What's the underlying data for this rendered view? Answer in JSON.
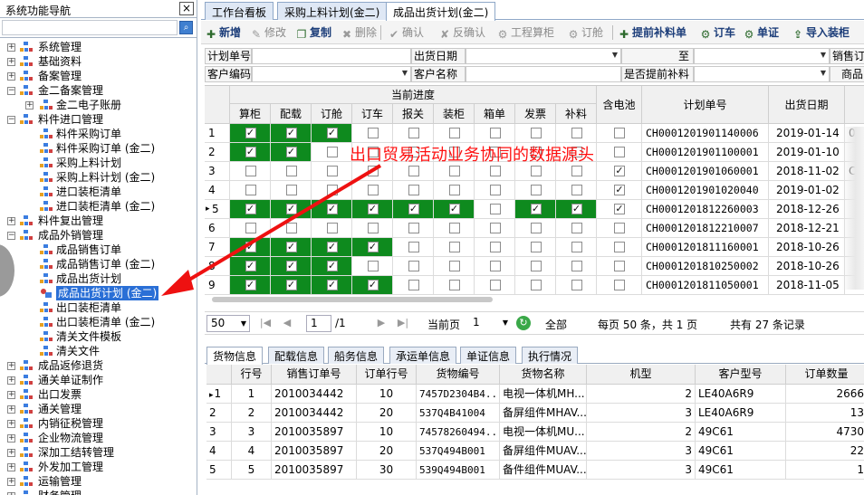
{
  "nav": {
    "title": "系统功能导航",
    "close": "×",
    "search_icon": "search-icon",
    "items": [
      {
        "label": "系统管理",
        "exp": "+",
        "level": 0
      },
      {
        "label": "基础资料",
        "exp": "+",
        "level": 0
      },
      {
        "label": "备案管理",
        "exp": "+",
        "level": 0
      },
      {
        "label": "金二备案管理",
        "exp": "−",
        "level": 0
      },
      {
        "label": "金二电子账册",
        "exp": "+",
        "level": 1
      },
      {
        "label": "料件进口管理",
        "exp": "−",
        "level": 0
      },
      {
        "label": "料件采购订单",
        "exp": "",
        "level": 1
      },
      {
        "label": "料件采购订单 (金二)",
        "exp": "",
        "level": 1
      },
      {
        "label": "采购上料计划",
        "exp": "",
        "level": 1
      },
      {
        "label": "采购上料计划 (金二)",
        "exp": "",
        "level": 1
      },
      {
        "label": "进口装柜清单",
        "exp": "",
        "level": 1
      },
      {
        "label": "进口装柜清单 (金二)",
        "exp": "",
        "level": 1
      },
      {
        "label": "料件复出管理",
        "exp": "+",
        "level": 0
      },
      {
        "label": "成品外销管理",
        "exp": "−",
        "level": 0
      },
      {
        "label": "成品销售订单",
        "exp": "",
        "level": 1
      },
      {
        "label": "成品销售订单 (金二)",
        "exp": "",
        "level": 1
      },
      {
        "label": "成品出货计划",
        "exp": "",
        "level": 1
      },
      {
        "label": "成品出货计划 (金二)",
        "exp": "",
        "level": 1,
        "selected": true
      },
      {
        "label": "出口装柜清单",
        "exp": "",
        "level": 1
      },
      {
        "label": "出口装柜清单 (金二)",
        "exp": "",
        "level": 1
      },
      {
        "label": "清关文件模板",
        "exp": "",
        "level": 1
      },
      {
        "label": "清关文件",
        "exp": "",
        "level": 1
      },
      {
        "label": "成品返修退货",
        "exp": "+",
        "level": 0
      },
      {
        "label": "通关单证制作",
        "exp": "+",
        "level": 0
      },
      {
        "label": "出口发票",
        "exp": "+",
        "level": 0
      },
      {
        "label": "通关管理",
        "exp": "+",
        "level": 0
      },
      {
        "label": "内销征税管理",
        "exp": "+",
        "level": 0
      },
      {
        "label": "企业物流管理",
        "exp": "+",
        "level": 0
      },
      {
        "label": "深加工结转管理",
        "exp": "+",
        "level": 0
      },
      {
        "label": "外发加工管理",
        "exp": "+",
        "level": 0
      },
      {
        "label": "运输管理",
        "exp": "+",
        "level": 0
      },
      {
        "label": "财务管理",
        "exp": "+",
        "level": 0
      }
    ]
  },
  "tabs": [
    "工作台看板",
    "采购上料计划(金二)",
    "成品出货计划(金二)"
  ],
  "toolbar": [
    {
      "icon": "plus-icon",
      "glyph": "✚",
      "label": "新增",
      "style": "bold"
    },
    {
      "icon": "edit-icon",
      "glyph": "✎",
      "label": "修改",
      "style": "dis"
    },
    {
      "icon": "copy-icon",
      "glyph": "❐",
      "label": "复制",
      "style": "bold"
    },
    {
      "icon": "delete-icon",
      "glyph": "✖",
      "label": "删除",
      "style": "dis"
    },
    {
      "icon": "check-icon",
      "glyph": "✔",
      "label": "确认",
      "style": "dis"
    },
    {
      "icon": "uncheck-icon",
      "glyph": "✘",
      "label": "反确认",
      "style": "dis"
    },
    {
      "icon": "gear-icon",
      "glyph": "⚙",
      "label": "工程算柜",
      "style": "dis"
    },
    {
      "icon": "gear-icon",
      "glyph": "⚙",
      "label": "订舱",
      "style": "dis"
    },
    {
      "icon": "plus-icon",
      "glyph": "✚",
      "label": "提前补料单",
      "style": "bold"
    },
    {
      "icon": "gear-icon",
      "glyph": "⚙",
      "label": "订车",
      "style": "bold"
    },
    {
      "icon": "gear-icon",
      "glyph": "⚙",
      "label": "单证",
      "style": "bold"
    },
    {
      "icon": "import-icon",
      "glyph": "⇪",
      "label": "导入装柜",
      "style": "bold"
    }
  ],
  "filters": {
    "plan_no": "计划单号",
    "ship_date": "出货日期",
    "to": "至",
    "sales": "销售订",
    "customer_code": "客户编码",
    "customer_name": "客户名称",
    "advance": "是否提前补料",
    "product": "商品"
  },
  "grid": {
    "group_header": "当前进度",
    "progress_cols": [
      "算柜",
      "配载",
      "订舱",
      "订车",
      "报关",
      "装柜",
      "箱单",
      "发票",
      "补料"
    ],
    "battery_col": "含电池",
    "plan_col": "计划单号",
    "date_col": "出货日期",
    "rows": [
      {
        "n": "1",
        "cur": false,
        "p": [
          1,
          1,
          1,
          0,
          0,
          0,
          0,
          0,
          0
        ],
        "g": [
          1,
          1,
          1,
          0,
          0,
          0,
          0,
          0,
          0
        ],
        "bat": 0,
        "plan": "CH0001201901140006",
        "date": "2019-01-14",
        "extra": "0"
      },
      {
        "n": "2",
        "cur": false,
        "p": [
          1,
          1,
          0,
          0,
          0,
          0,
          0,
          0,
          0
        ],
        "g": [
          1,
          1,
          0,
          0,
          0,
          0,
          0,
          0,
          0
        ],
        "bat": 0,
        "plan": "CH0001201901100001",
        "date": "2019-01-10",
        "extra": ""
      },
      {
        "n": "3",
        "cur": false,
        "p": [
          0,
          0,
          0,
          0,
          0,
          0,
          0,
          0,
          0
        ],
        "g": [
          0,
          0,
          0,
          0,
          0,
          0,
          0,
          0,
          0
        ],
        "bat": 1,
        "plan": "CH0001201901060001",
        "date": "2018-11-02",
        "extra": "C"
      },
      {
        "n": "4",
        "cur": false,
        "p": [
          0,
          0,
          0,
          0,
          0,
          0,
          0,
          0,
          0
        ],
        "g": [
          0,
          0,
          0,
          0,
          0,
          0,
          0,
          0,
          0
        ],
        "bat": 1,
        "plan": "CH0001201901020040",
        "date": "2019-01-02",
        "extra": ""
      },
      {
        "n": "5",
        "cur": true,
        "p": [
          1,
          1,
          1,
          1,
          1,
          1,
          0,
          1,
          1
        ],
        "g": [
          1,
          1,
          1,
          1,
          1,
          1,
          0,
          1,
          1
        ],
        "bat": 1,
        "plan": "CH0001201812260003",
        "date": "2018-12-26",
        "extra": ""
      },
      {
        "n": "6",
        "cur": false,
        "p": [
          0,
          0,
          0,
          0,
          0,
          0,
          0,
          0,
          0
        ],
        "g": [
          0,
          0,
          0,
          0,
          0,
          0,
          0,
          0,
          0
        ],
        "bat": 0,
        "plan": "CH0001201812210007",
        "date": "2018-12-21",
        "extra": ""
      },
      {
        "n": "7",
        "cur": false,
        "p": [
          1,
          1,
          1,
          1,
          0,
          0,
          0,
          0,
          0
        ],
        "g": [
          1,
          1,
          1,
          1,
          0,
          0,
          0,
          0,
          0
        ],
        "bat": 0,
        "plan": "CH0001201811160001",
        "date": "2018-10-26",
        "extra": ""
      },
      {
        "n": "8",
        "cur": false,
        "p": [
          1,
          1,
          1,
          0,
          0,
          0,
          0,
          0,
          0
        ],
        "g": [
          1,
          1,
          1,
          0,
          0,
          0,
          0,
          0,
          0
        ],
        "bat": 0,
        "plan": "CH0001201810250002",
        "date": "2018-10-26",
        "extra": ""
      },
      {
        "n": "9",
        "cur": false,
        "p": [
          1,
          1,
          1,
          1,
          0,
          0,
          0,
          0,
          0
        ],
        "g": [
          1,
          1,
          1,
          1,
          0,
          0,
          0,
          0,
          0
        ],
        "bat": 0,
        "plan": "CH0001201811050001",
        "date": "2018-11-05",
        "extra": ""
      }
    ]
  },
  "annotation": "出口贸易活动业务协同的数据源头",
  "pager": {
    "size": "50",
    "page": "1",
    "total_pages": "/1",
    "current_label": "当前页",
    "current_value": "1",
    "all": "全部",
    "summary": "每页 50 条，共 1 页",
    "records": "共有 27 条记录"
  },
  "bottom_tabs": [
    "货物信息",
    "配载信息",
    "船务信息",
    "承运单信息",
    "单证信息",
    "执行情况"
  ],
  "detail": {
    "cols": [
      "行号",
      "销售订单号",
      "订单行号",
      "货物编号",
      "货物名称",
      "机型",
      "客户型号",
      "订单数量"
    ],
    "rows": [
      {
        "n": "1",
        "cur": true,
        "line": "1",
        "so": "2010034442",
        "sol": "10",
        "code": "7457D2304B4...",
        "name": "电视一体机MH...",
        "model": "2",
        "cust": "LE40A6R9",
        "qty": "2666"
      },
      {
        "n": "2",
        "cur": false,
        "line": "2",
        "so": "2010034442",
        "sol": "20",
        "code": "537Q4B41004",
        "name": "备屏组件MHAV...",
        "model": "3",
        "cust": "LE40A6R9",
        "qty": "13"
      },
      {
        "n": "3",
        "cur": false,
        "line": "3",
        "so": "2010035897",
        "sol": "10",
        "code": "74578260494...",
        "name": "电视一体机MU...",
        "model": "2",
        "cust": "49C61",
        "qty": "4730"
      },
      {
        "n": "4",
        "cur": false,
        "line": "4",
        "so": "2010035897",
        "sol": "20",
        "code": "537Q494B001",
        "name": "备屏组件MUAV...",
        "model": "3",
        "cust": "49C61",
        "qty": "22"
      },
      {
        "n": "5",
        "cur": false,
        "line": "5",
        "so": "2010035897",
        "sol": "30",
        "code": "539Q494B001",
        "name": "备件组件MUAV...",
        "model": "3",
        "cust": "49C61",
        "qty": "1"
      }
    ]
  }
}
